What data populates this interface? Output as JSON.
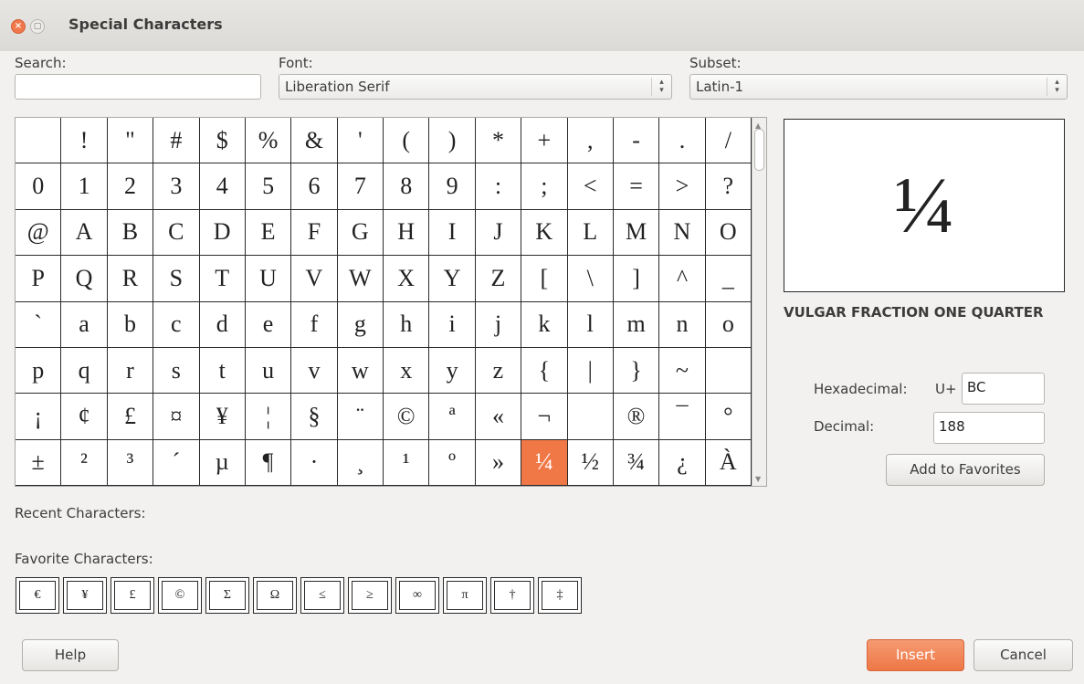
{
  "window": {
    "title": "Special Characters",
    "close_icon": "×",
    "minimize_icon": "▢"
  },
  "search": {
    "label": "Search:",
    "value": ""
  },
  "font": {
    "label": "Font:",
    "value": "Liberation Serif"
  },
  "subset": {
    "label": "Subset:",
    "value": "Latin-1"
  },
  "grid": {
    "rows": [
      [
        " ",
        "!",
        "\"",
        "#",
        "$",
        "%",
        "&",
        "'",
        "(",
        ")",
        "*",
        "+",
        ",",
        "-",
        ".",
        "/"
      ],
      [
        "0",
        "1",
        "2",
        "3",
        "4",
        "5",
        "6",
        "7",
        "8",
        "9",
        ":",
        ";",
        "<",
        "=",
        ">",
        "?"
      ],
      [
        "@",
        "A",
        "B",
        "C",
        "D",
        "E",
        "F",
        "G",
        "H",
        "I",
        "J",
        "K",
        "L",
        "M",
        "N",
        "O"
      ],
      [
        "P",
        "Q",
        "R",
        "S",
        "T",
        "U",
        "V",
        "W",
        "X",
        "Y",
        "Z",
        "[",
        "\\",
        "]",
        "^",
        "_"
      ],
      [
        "`",
        "a",
        "b",
        "c",
        "d",
        "e",
        "f",
        "g",
        "h",
        "i",
        "j",
        "k",
        "l",
        "m",
        "n",
        "o"
      ],
      [
        "p",
        "q",
        "r",
        "s",
        "t",
        "u",
        "v",
        "w",
        "x",
        "y",
        "z",
        "{",
        "|",
        "}",
        "~",
        ""
      ],
      [
        "¡",
        "¢",
        "£",
        "¤",
        "¥",
        "¦",
        "§",
        "¨",
        "©",
        "ª",
        "«",
        "¬",
        "",
        "®",
        "¯",
        "°"
      ],
      [
        "±",
        "²",
        "³",
        "´",
        "µ",
        "¶",
        "·",
        "¸",
        "¹",
        "º",
        "»",
        "¼",
        "½",
        "¾",
        "¿",
        "À"
      ]
    ],
    "selected": "¼"
  },
  "preview": {
    "character": "¼",
    "name": "VULGAR FRACTION ONE QUARTER"
  },
  "hex": {
    "label": "Hexadecimal:",
    "prefix": "U+",
    "value": "BC"
  },
  "decimal": {
    "label": "Decimal:",
    "value": "188"
  },
  "add_favorites_label": "Add to Favorites",
  "recent": {
    "label": "Recent Characters:"
  },
  "favorites": {
    "label": "Favorite Characters:",
    "items": [
      "€",
      "¥",
      "£",
      "©",
      "Σ",
      "Ω",
      "≤",
      "≥",
      "∞",
      "π",
      "†",
      "‡"
    ]
  },
  "buttons": {
    "help": "Help",
    "insert": "Insert",
    "cancel": "Cancel"
  },
  "colors": {
    "accent": "#f07746"
  }
}
